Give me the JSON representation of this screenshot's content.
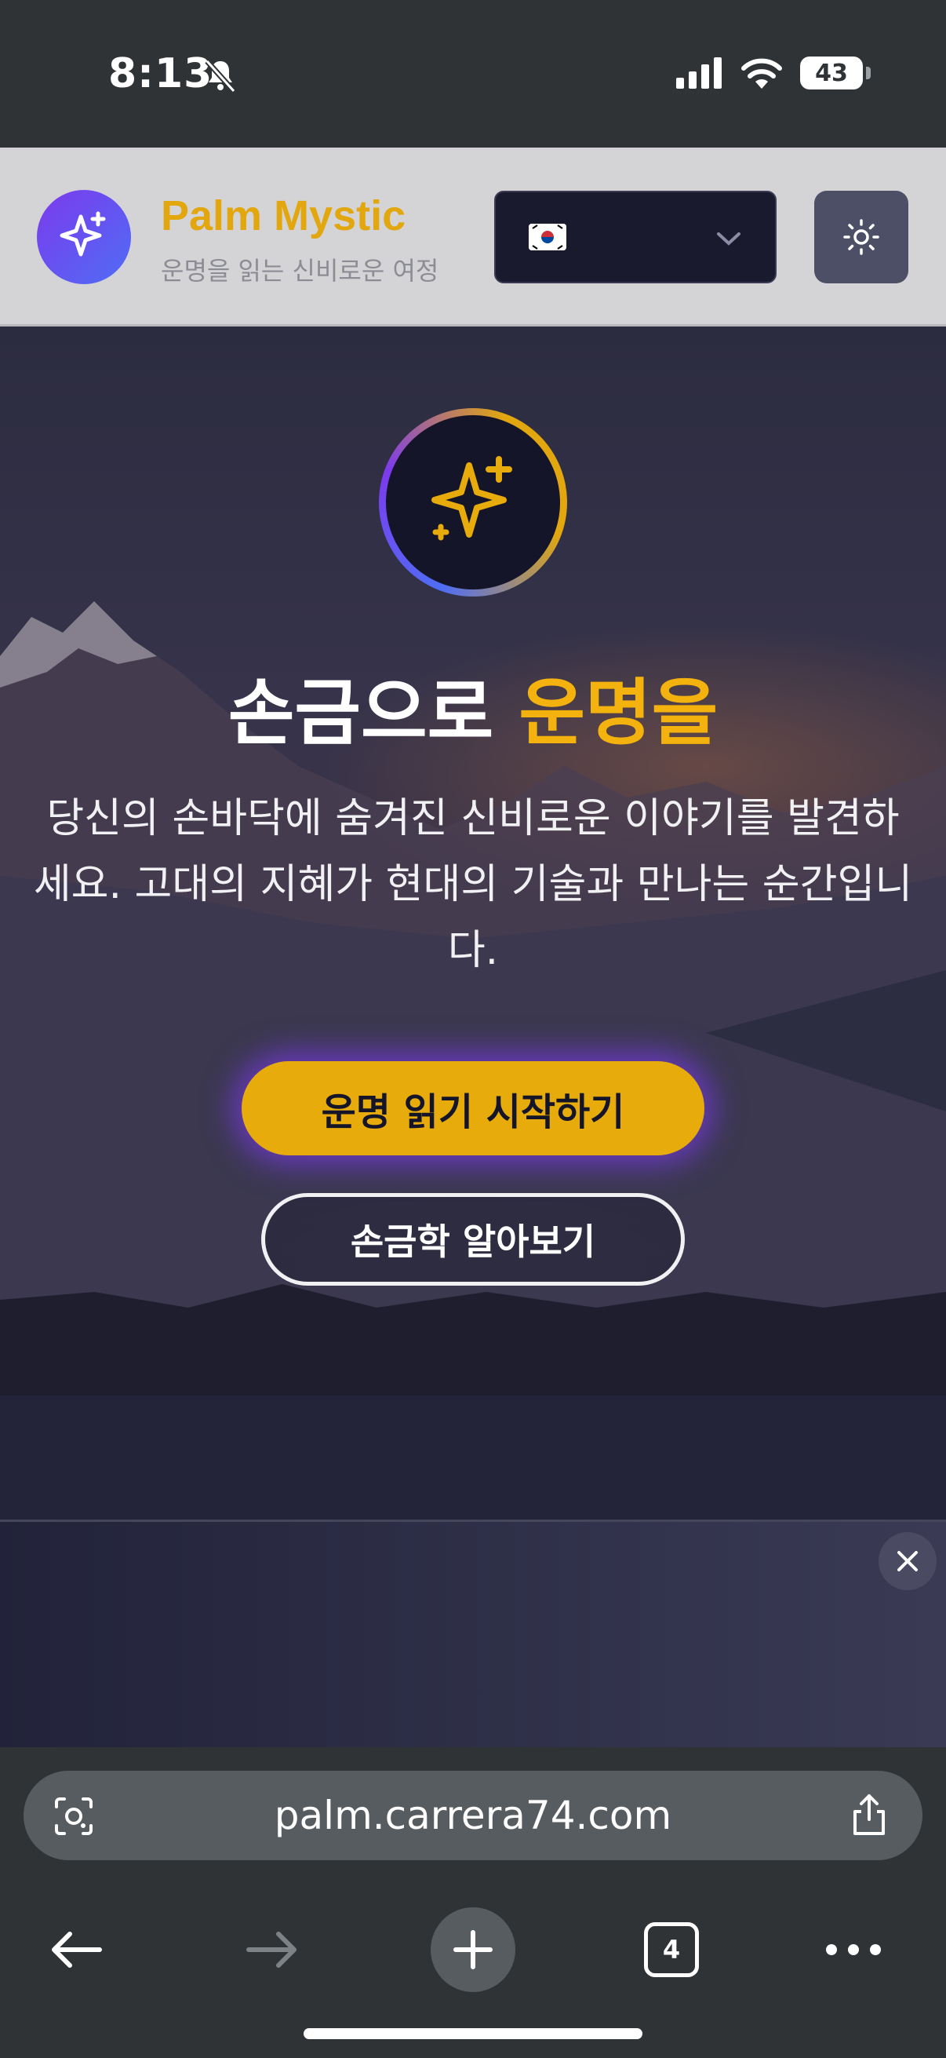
{
  "status_bar": {
    "time": "8:13",
    "battery": "43"
  },
  "header": {
    "brand_name": "Palm Mystic",
    "brand_tagline": "운명을 읽는 신비로운 여정",
    "language_flag": "🇰🇷"
  },
  "hero": {
    "title_main": "손금으로 ",
    "title_accent": "운명을",
    "description": "당신의 손바닥에 숨겨진 신비로운 이야기를 발견하세요. 고대의 지혜가 현대의 기술과 만나는 순간입니다.",
    "primary_cta": "운명 읽기 시작하기",
    "secondary_cta": "손금학 알아보기"
  },
  "browser": {
    "url": "palm.carrera74.com",
    "tab_count": "4"
  },
  "colors": {
    "accent_gold": "#e7ab0c",
    "brand_purple": "#7c3aed",
    "header_bg": "#d4d4d7"
  }
}
